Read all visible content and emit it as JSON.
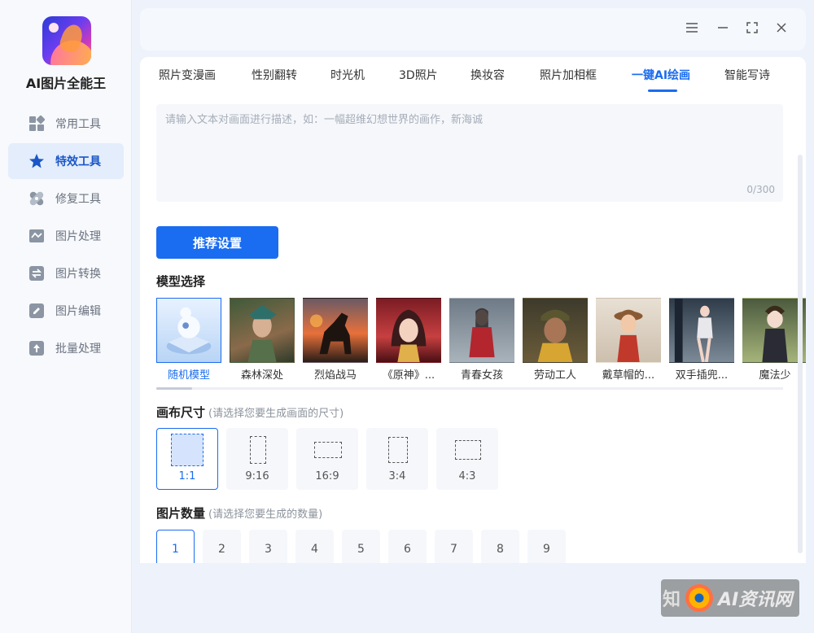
{
  "app": {
    "title": "AI图片全能王"
  },
  "sidebar": {
    "items": [
      {
        "label": "常用工具",
        "icon": "grid-icon",
        "active": false
      },
      {
        "label": "特效工具",
        "icon": "star-icon",
        "active": true
      },
      {
        "label": "修复工具",
        "icon": "bandage-icon",
        "active": false
      },
      {
        "label": "图片处理",
        "icon": "image-wave-icon",
        "active": false
      },
      {
        "label": "图片转换",
        "icon": "convert-icon",
        "active": false
      },
      {
        "label": "图片编辑",
        "icon": "edit-icon",
        "active": false
      },
      {
        "label": "批量处理",
        "icon": "upload-icon",
        "active": false
      }
    ]
  },
  "window_controls": [
    "menu-icon",
    "minimize-icon",
    "fullscreen-icon",
    "close-icon"
  ],
  "tabs": [
    {
      "label": "照片变漫画"
    },
    {
      "label": "性别翻转"
    },
    {
      "label": "时光机"
    },
    {
      "label": "3D照片"
    },
    {
      "label": "换妆容"
    },
    {
      "label": "照片加相框"
    },
    {
      "label": "一键AI绘画",
      "active": true
    },
    {
      "label": "智能写诗"
    }
  ],
  "prompt": {
    "placeholder": "请输入文本对画面进行描述，如：一幅超维幻想世界的画作，新海诚",
    "value": "",
    "counter": "0/300"
  },
  "recommend_button": "推荐设置",
  "model_section": {
    "title": "模型选择",
    "models": [
      {
        "name": "随机模型",
        "active": true
      },
      {
        "name": "森林深处"
      },
      {
        "name": "烈焰战马"
      },
      {
        "name": "《原神》..."
      },
      {
        "name": "青春女孩"
      },
      {
        "name": "劳动工人"
      },
      {
        "name": "戴草帽的..."
      },
      {
        "name": "双手插兜..."
      },
      {
        "name": "魔法少"
      }
    ]
  },
  "canvas_section": {
    "title": "画布尺寸",
    "hint": "(请选择您要生成画面的尺寸)",
    "options": [
      {
        "label": "1:1",
        "active": true
      },
      {
        "label": "9:16"
      },
      {
        "label": "16:9"
      },
      {
        "label": "3:4"
      },
      {
        "label": "4:3"
      }
    ]
  },
  "count_section": {
    "title": "图片数量",
    "hint": "(请选择您要生成的数量)",
    "options": [
      "1",
      "2",
      "3",
      "4",
      "5",
      "6",
      "7",
      "8",
      "9"
    ],
    "selected": "1"
  },
  "watermark": {
    "prefix": "知",
    "text": "AI资讯网"
  },
  "colors": {
    "accent": "#1a6cf0",
    "sidebar_active_bg": "#e3edfb"
  }
}
